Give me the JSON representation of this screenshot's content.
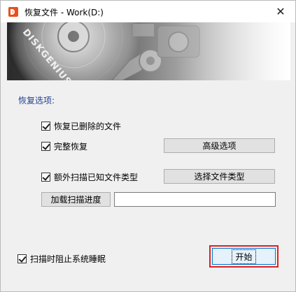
{
  "window": {
    "title": "恢复文件 - Work(D:)",
    "close_glyph": "✕"
  },
  "banner": {
    "brand_text": "DISKGENIUS"
  },
  "options": {
    "group_title": "恢复选项:",
    "recover_deleted": {
      "label": "恢复已删除的文件",
      "checked": true
    },
    "full_recovery": {
      "label": "完整恢复",
      "checked": true
    },
    "extra_scan": {
      "label": "额外扫描已知文件类型",
      "checked": true
    },
    "advanced_button": "高级选项",
    "select_types_button": "选择文件类型",
    "load_progress_button": "加载扫描进度",
    "load_progress_value": ""
  },
  "footer": {
    "prevent_sleep": {
      "label": "扫描时阻止系统睡眠",
      "checked": true
    },
    "start_button": "开始"
  },
  "colors": {
    "group_title": "#1f3f8f",
    "highlight": "#e02020",
    "default_button_border": "#0078d7",
    "brand_icon": "#e8501c"
  }
}
